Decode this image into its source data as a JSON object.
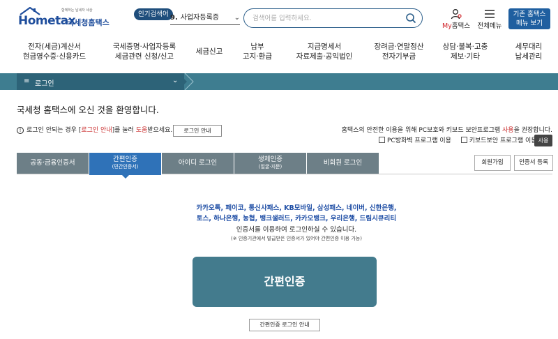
{
  "header": {
    "logo_tagline": "함께하는 납세자 세상",
    "logo_brand": "Hometax",
    "logo_subtitle": "국세청홈택스",
    "popular_label": "인기검색어",
    "popular_rank": "9.",
    "popular_term": "사업자등록증",
    "search_placeholder": "검색어를 입력하세요.",
    "my_hometax_prefix": "My",
    "my_hometax_label": "홈택스",
    "all_menu_label": "전체메뉴",
    "legacy_btn_line1": "기존 홈택스",
    "legacy_btn_line2": "메뉴 보기"
  },
  "nav": {
    "items": [
      {
        "line1": "전자(세금)계산서",
        "line2": "현금영수증·신용카드"
      },
      {
        "line1": "국세증명·사업자등록",
        "line2": "세금관련 신청/신고"
      },
      {
        "line1": "세금신고",
        "line2": ""
      },
      {
        "line1": "납부",
        "line2": "고지·환급"
      },
      {
        "line1": "지급명세서",
        "line2": "자료제출·공익법인"
      },
      {
        "line1": "장려금·연말정산",
        "line2": "전자기부금"
      },
      {
        "line1": "상담·불복·고충",
        "line2": "제보·기타"
      },
      {
        "line1": "세무대리",
        "line2": "납세관리"
      }
    ]
  },
  "breadcrumb": {
    "menu_icon": "≡",
    "label": "로그인",
    "chevron": "⌄"
  },
  "main": {
    "welcome": "국세청 홈택스에 오신 것을 환영합니다.",
    "info_prefix": "로그인 안되는 경우 [",
    "info_link": "로그인 안내",
    "info_middle": "]를 눌러 ",
    "info_help": "도움",
    "info_suffix": "받으세요.",
    "guide_btn": "로그인 안내",
    "security_prefix": "홈택스의 안전한 이용을 위해 PC보호와 키보드 보안프로그램 ",
    "security_use": "사용",
    "security_suffix": "을 권장합니다.",
    "check_pc": "PC방화벽 프로그램 이용",
    "check_keyboard": "키보드보안 프로그램 이용",
    "use_btn": "사용"
  },
  "tabs": [
    {
      "label": "공동·금융인증서",
      "sub": ""
    },
    {
      "label": "간편인증",
      "sub": "(민간인증서)"
    },
    {
      "label": "아이디 로그인",
      "sub": ""
    },
    {
      "label": "생체인증",
      "sub": "(얼굴·지문)"
    },
    {
      "label": "비회원 로그인",
      "sub": ""
    }
  ],
  "side_buttons": {
    "signup": "회원가입",
    "cert_register": "인증서 등록"
  },
  "simple_auth": {
    "providers_line1": "카카오톡, 페이코, 통신사패스, KB모바일, 삼성패스, 네이버, 신한은행,",
    "providers_line2": "토스, 하나은행, 농협, 뱅크샐러드, 카카오뱅크, 우리은행, 드림시큐리티",
    "description": "인증서를 이용하여 로그인하실 수 있습니다.",
    "note": "(※ 인증기관에서 발급받은 인증서가 있어야 간편인증 이용 가능)",
    "button_label": "간편인증",
    "guide_button": "간편인증 로그인 안내"
  }
}
